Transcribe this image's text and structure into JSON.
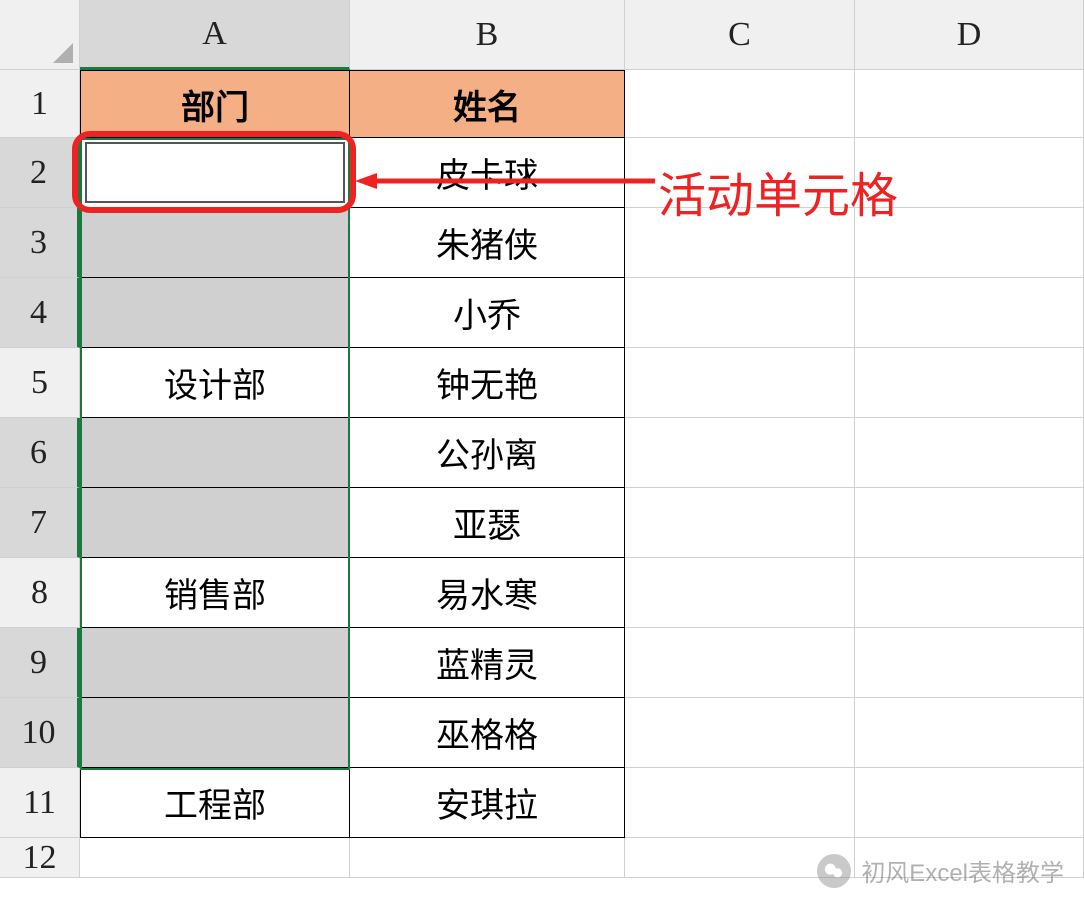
{
  "columns": [
    "A",
    "B",
    "C",
    "D"
  ],
  "rows": [
    "1",
    "2",
    "3",
    "4",
    "5",
    "6",
    "7",
    "8",
    "9",
    "10",
    "11",
    "12"
  ],
  "header": {
    "a": "部门",
    "b": "姓名"
  },
  "data": {
    "a5": "设计部",
    "a8": "销售部",
    "a11": "工程部",
    "b2": "皮卡球",
    "b3": "朱猪侠",
    "b4": "小乔",
    "b5": "钟无艳",
    "b6": "公孙离",
    "b7": "亚瑟",
    "b8": "易水寒",
    "b9": "蓝精灵",
    "b10": "巫格格",
    "b11": "安琪拉"
  },
  "annotation": {
    "label": "活动单元格"
  },
  "watermark": {
    "text": "初风Excel表格教学"
  }
}
